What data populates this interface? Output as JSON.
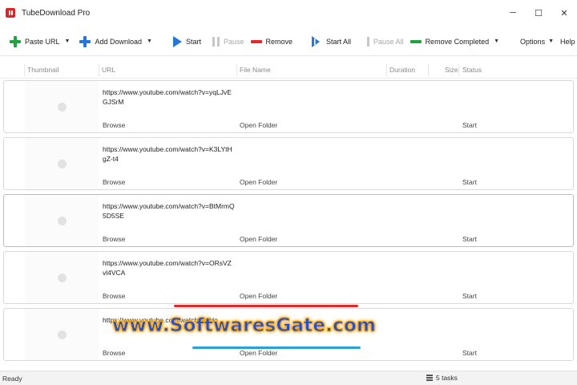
{
  "window": {
    "title": "TubeDownload Pro",
    "controls": {
      "minimize": "─",
      "maximize": "☐",
      "close": "✕"
    }
  },
  "toolbar": {
    "paste_url": "Paste URL",
    "add_download": "Add Download",
    "start": "Start",
    "pause": "Pause",
    "remove": "Remove",
    "start_all": "Start All",
    "pause_all": "Pause All",
    "remove_completed": "Remove Completed",
    "options": "Options",
    "help": "Help",
    "caret": "▼"
  },
  "columns": {
    "thumbnail": "Thumbnail",
    "url": "URL",
    "file_name": "File Name",
    "duration": "Duration",
    "size": "Size",
    "status": "Status"
  },
  "rows": [
    {
      "url": "https://www.youtube.com/watch?v=yqLJvEGJSrM",
      "browse": "Browse",
      "open_folder": "Open Folder",
      "action": "Start"
    },
    {
      "url": "https://www.youtube.com/watch?v=K3LYtHgZ-t4",
      "browse": "Browse",
      "open_folder": "Open Folder",
      "action": "Start"
    },
    {
      "url": "https://www.youtube.com/watch?v=BtMrmQ5D5SE",
      "browse": "Browse",
      "open_folder": "Open Folder",
      "action": "Start"
    },
    {
      "url": "https://www.youtube.com/watch?v=ORsVZvl4VCA",
      "browse": "Browse",
      "open_folder": "Open Folder",
      "action": "Start"
    },
    {
      "url": "https://www.youtube.com/watch?v=Ho",
      "browse": "Browse",
      "open_folder": "Open Folder",
      "action": "Start"
    }
  ],
  "watermark": {
    "text": "www.SoftwaresGate.com"
  },
  "statusbar": {
    "left": "Ready",
    "tasks": "5 tasks"
  },
  "colors": {
    "accent_red": "#d8262b",
    "add_green": "#23a242",
    "add_blue": "#2676d9",
    "remove_red": "#e52727"
  }
}
